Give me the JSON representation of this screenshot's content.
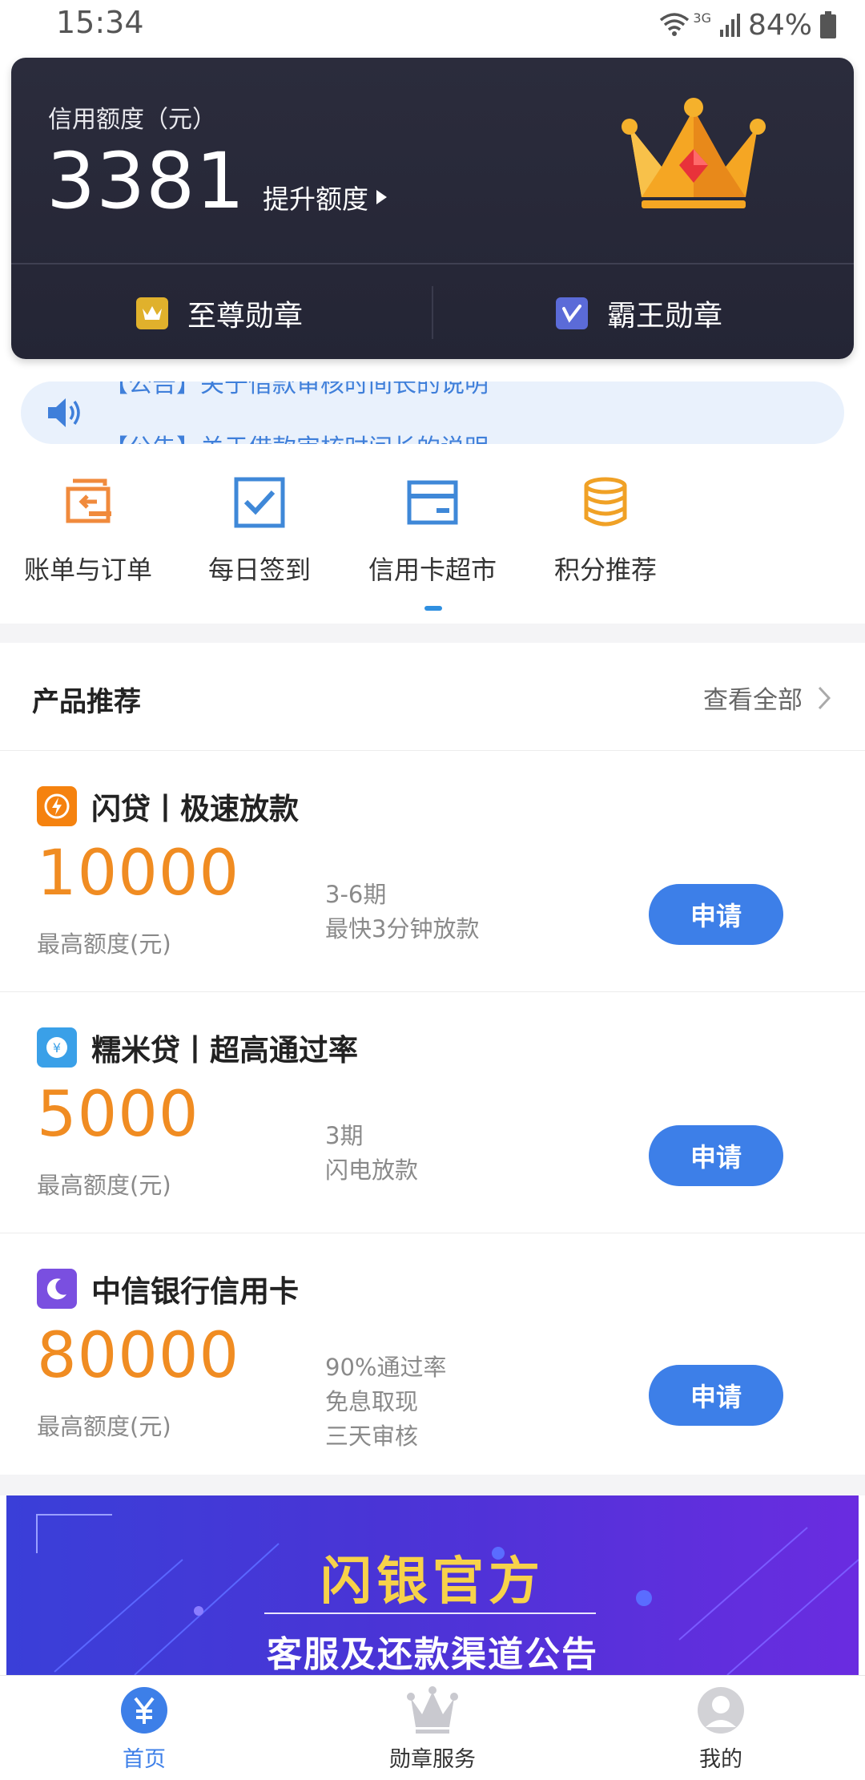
{
  "status_bar": {
    "time": "15:34",
    "network": "3G",
    "battery": "84%"
  },
  "credit": {
    "label": "信用额度（元）",
    "amount": "3381",
    "raise_link": "提升额度",
    "badges": [
      {
        "label": "至尊勋章",
        "icon": "crown-badge-icon",
        "color": "#e0b12c"
      },
      {
        "label": "霸王勋章",
        "icon": "v-badge-icon",
        "color": "#5b6bd8"
      }
    ]
  },
  "notice": {
    "lines": [
      "【公告】关于借款审核时间长的说明",
      "【公告】关于借款审核时间长的说明"
    ]
  },
  "quick_menu": [
    {
      "label": "账单与订单",
      "icon": "bill-order-icon",
      "color": "#f08a3c"
    },
    {
      "label": "每日签到",
      "icon": "checkin-icon",
      "color": "#3f88d8"
    },
    {
      "label": "信用卡超市",
      "icon": "card-market-icon",
      "color": "#3f88d8"
    },
    {
      "label": "积分推荐",
      "icon": "coins-icon",
      "color": "#f0a126"
    }
  ],
  "products_section": {
    "title": "产品推荐",
    "more": "查看全部"
  },
  "products": [
    {
      "name": "闪贷丨极速放款",
      "logo": "lightning-logo-icon",
      "logo_color": "#f5820f",
      "amount": "10000",
      "amount_label": "最高额度(元)",
      "features": [
        "3-6期",
        "最快3分钟放款"
      ],
      "apply": "申请"
    },
    {
      "name": "糯米贷丨超高通过率",
      "logo": "rice-logo-icon",
      "logo_color": "#3aa0e8",
      "amount": "5000",
      "amount_label": "最高额度(元)",
      "features": [
        "3期",
        "闪电放款"
      ],
      "apply": "申请"
    },
    {
      "name": "中信银行信用卡",
      "logo": "moon-logo-icon",
      "logo_color": "#7a4fe0",
      "amount": "80000",
      "amount_label": "最高额度(元)",
      "features": [
        "90%通过率",
        "免息取现",
        "三天审核"
      ],
      "apply": "申请"
    }
  ],
  "banner": {
    "title": "闪银官方",
    "subtitle": "客服及还款渠道公告"
  },
  "bottom_nav": [
    {
      "label": "首页",
      "icon": "home-yen-icon",
      "active": true,
      "color": "#3d7fe8"
    },
    {
      "label": "勋章服务",
      "icon": "crown-nav-icon",
      "active": false,
      "color": "#333333"
    },
    {
      "label": "我的",
      "icon": "profile-icon",
      "active": false,
      "color": "#333333"
    }
  ]
}
